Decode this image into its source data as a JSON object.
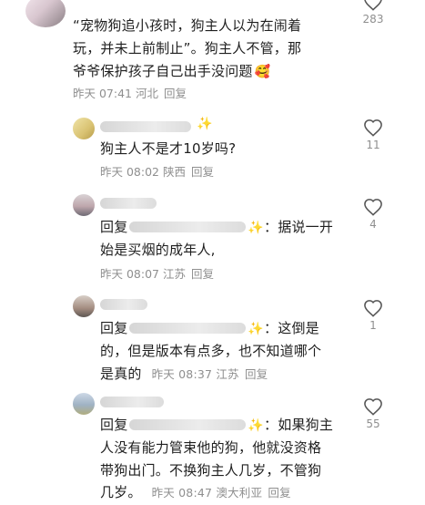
{
  "comments": [
    {
      "lines": [
        "“宠物狗追小孩时，狗主人以为在闹着",
        "玩，并未上前制止”。狗主人不管，那",
        "爷爷保护孩子自己出手没问题"
      ],
      "meta": "昨天 07:41 河北",
      "reply_label": "回复",
      "likes": "283",
      "emoji": "🥰"
    },
    {
      "lines": [
        "狗主人不是才10岁吗?"
      ],
      "meta": "昨天 08:02 陕西",
      "reply_label": "回复",
      "likes": "11",
      "name_suffix": "✨"
    },
    {
      "reply_prefix": "回复",
      "line1_rest": "：据说一开",
      "lines2": "始是买烟的成年人,",
      "meta": "昨天 08:07 江苏",
      "reply_label": "回复",
      "likes": "4",
      "name_spark": "✨"
    },
    {
      "reply_prefix": "回复",
      "line1_rest": "：这倒是",
      "lines2": "的，但是版本有点多，也不知道哪个",
      "line3_text": "是真的",
      "meta": "昨天 08:37 江苏",
      "reply_label": "回复",
      "likes": "1",
      "name_spark": "✨"
    },
    {
      "reply_prefix": "回复",
      "line1_rest": "：如果狗主",
      "lines2": "人没有能力管束他的狗，他就没资格",
      "lines3": "带狗出门。不换狗主人几岁，不管狗",
      "line4_text": "几岁。",
      "meta": "昨天 08:47 澳大利亚",
      "reply_label": "回复",
      "likes": "55",
      "name_spark": "✨"
    }
  ],
  "colors": {
    "text": "#1f1f1f",
    "meta": "#8f8f8f",
    "sparkle": "#f3c400",
    "heart_stroke": "#555555"
  },
  "icons": {
    "like": "heart-outline-icon"
  }
}
